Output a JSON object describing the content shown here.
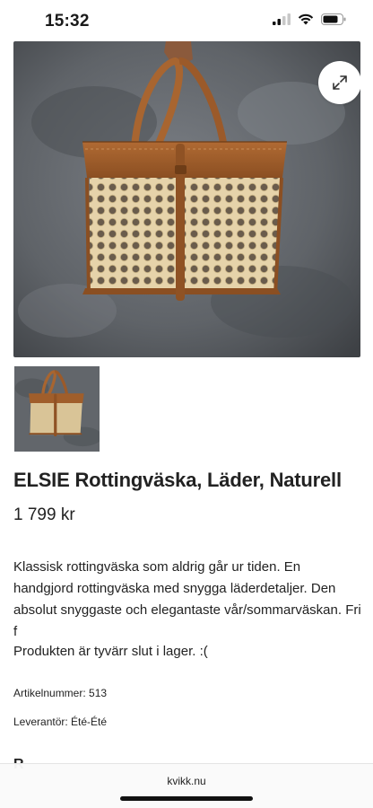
{
  "status_bar": {
    "time": "15:32",
    "icons": [
      "cellular-signal-icon",
      "wifi-icon",
      "battery-icon"
    ]
  },
  "product_image": {
    "icons": [
      "expand-icon"
    ],
    "thumbnails_count": 1
  },
  "product": {
    "title": "ELSIE Rottingväska, Läder, Naturell",
    "price": "1 799 kr",
    "description": "Klassisk rottingväska som aldrig går ur tiden. En handgjord rottingväska med snygga läderdetaljer. Den absolut snyggaste och elegantaste vår/sommarväskan. Fri f",
    "stock_status": "Produkten är tyvärr slut i lager. :(",
    "article_number": "Artikelnummer: 513",
    "supplier": "Leverantör: Été-Été",
    "next_section_partial": "R"
  },
  "browser": {
    "url": "kvikk.nu"
  },
  "colors": {
    "leather": "#9b5a2a",
    "rattan": "#e6d3aa",
    "wall": "#5f6368"
  }
}
